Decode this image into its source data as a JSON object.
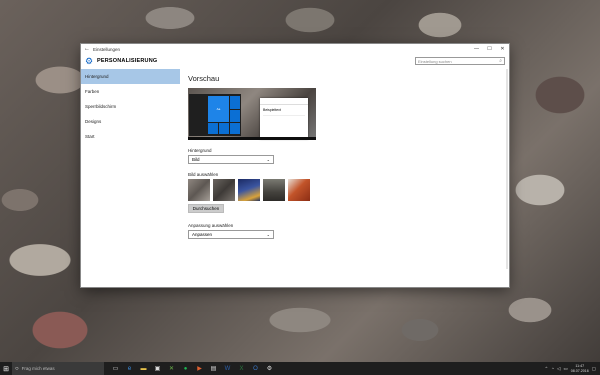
{
  "window": {
    "title": "Einstellungen",
    "back_glyph": "←",
    "minimize_glyph": "—",
    "maximize_glyph": "☐",
    "close_glyph": "✕"
  },
  "header": {
    "title": "PERSONALISIERUNG",
    "search_placeholder": "Einstellung suchen"
  },
  "nav": {
    "items": [
      {
        "label": "Hintergrund",
        "active": true
      },
      {
        "label": "Farben"
      },
      {
        "label": "Sperrbildschirm"
      },
      {
        "label": "Designs"
      },
      {
        "label": "Start"
      }
    ]
  },
  "main": {
    "preview_heading": "Vorschau",
    "sample_text": "Beispieltext",
    "tile_label": "Aa",
    "background_label": "Hintergrund",
    "background_value": "Bild",
    "choose_picture_label": "Bild auswählen",
    "browse_button": "Durchsuchen",
    "fit_label": "Anpassung auswählen",
    "fit_value": "Anpassen",
    "thumbnails": [
      {
        "name": "stones",
        "color": "#7d7670"
      },
      {
        "name": "rocks",
        "color": "#58524e"
      },
      {
        "name": "night",
        "color": "#2a3f7a"
      },
      {
        "name": "mountain",
        "color": "#54524b"
      },
      {
        "name": "red",
        "color": "#c2542a"
      }
    ]
  },
  "taskbar": {
    "search_text": "Frag mich etwas",
    "time": "11:47",
    "date": "08.07.2016"
  },
  "colors": {
    "accent": "#0a63c6",
    "nav_selected": "#a7c7e7"
  }
}
